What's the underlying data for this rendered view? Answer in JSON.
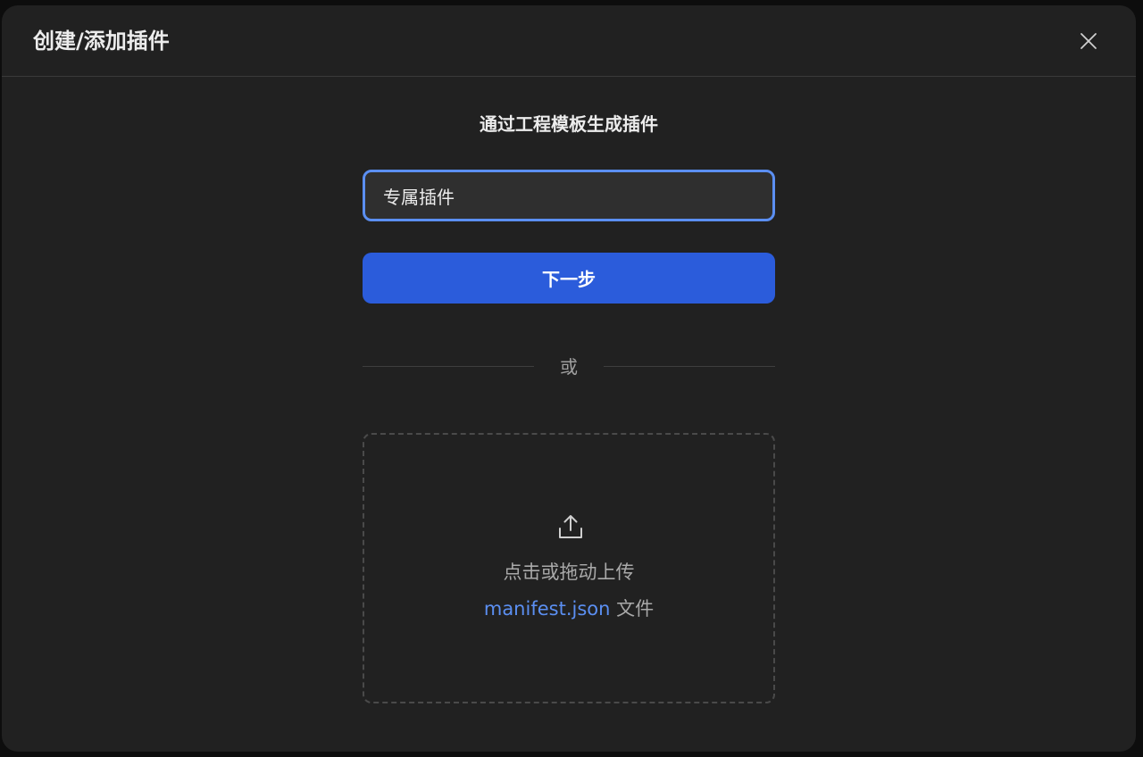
{
  "dialog": {
    "title": "创建/添加插件",
    "section_title": "通过工程模板生成插件",
    "name_input": {
      "value": "专属插件",
      "accent_color": "#5b8ff2"
    },
    "next_button": {
      "label": "下一步",
      "color": "#2b5cdb"
    },
    "divider_text": "或",
    "upload": {
      "icon": "upload-icon",
      "instruction": "点击或拖动上传",
      "file_name": "manifest.json",
      "file_suffix": " 文件"
    },
    "close_icon": "close-icon"
  }
}
